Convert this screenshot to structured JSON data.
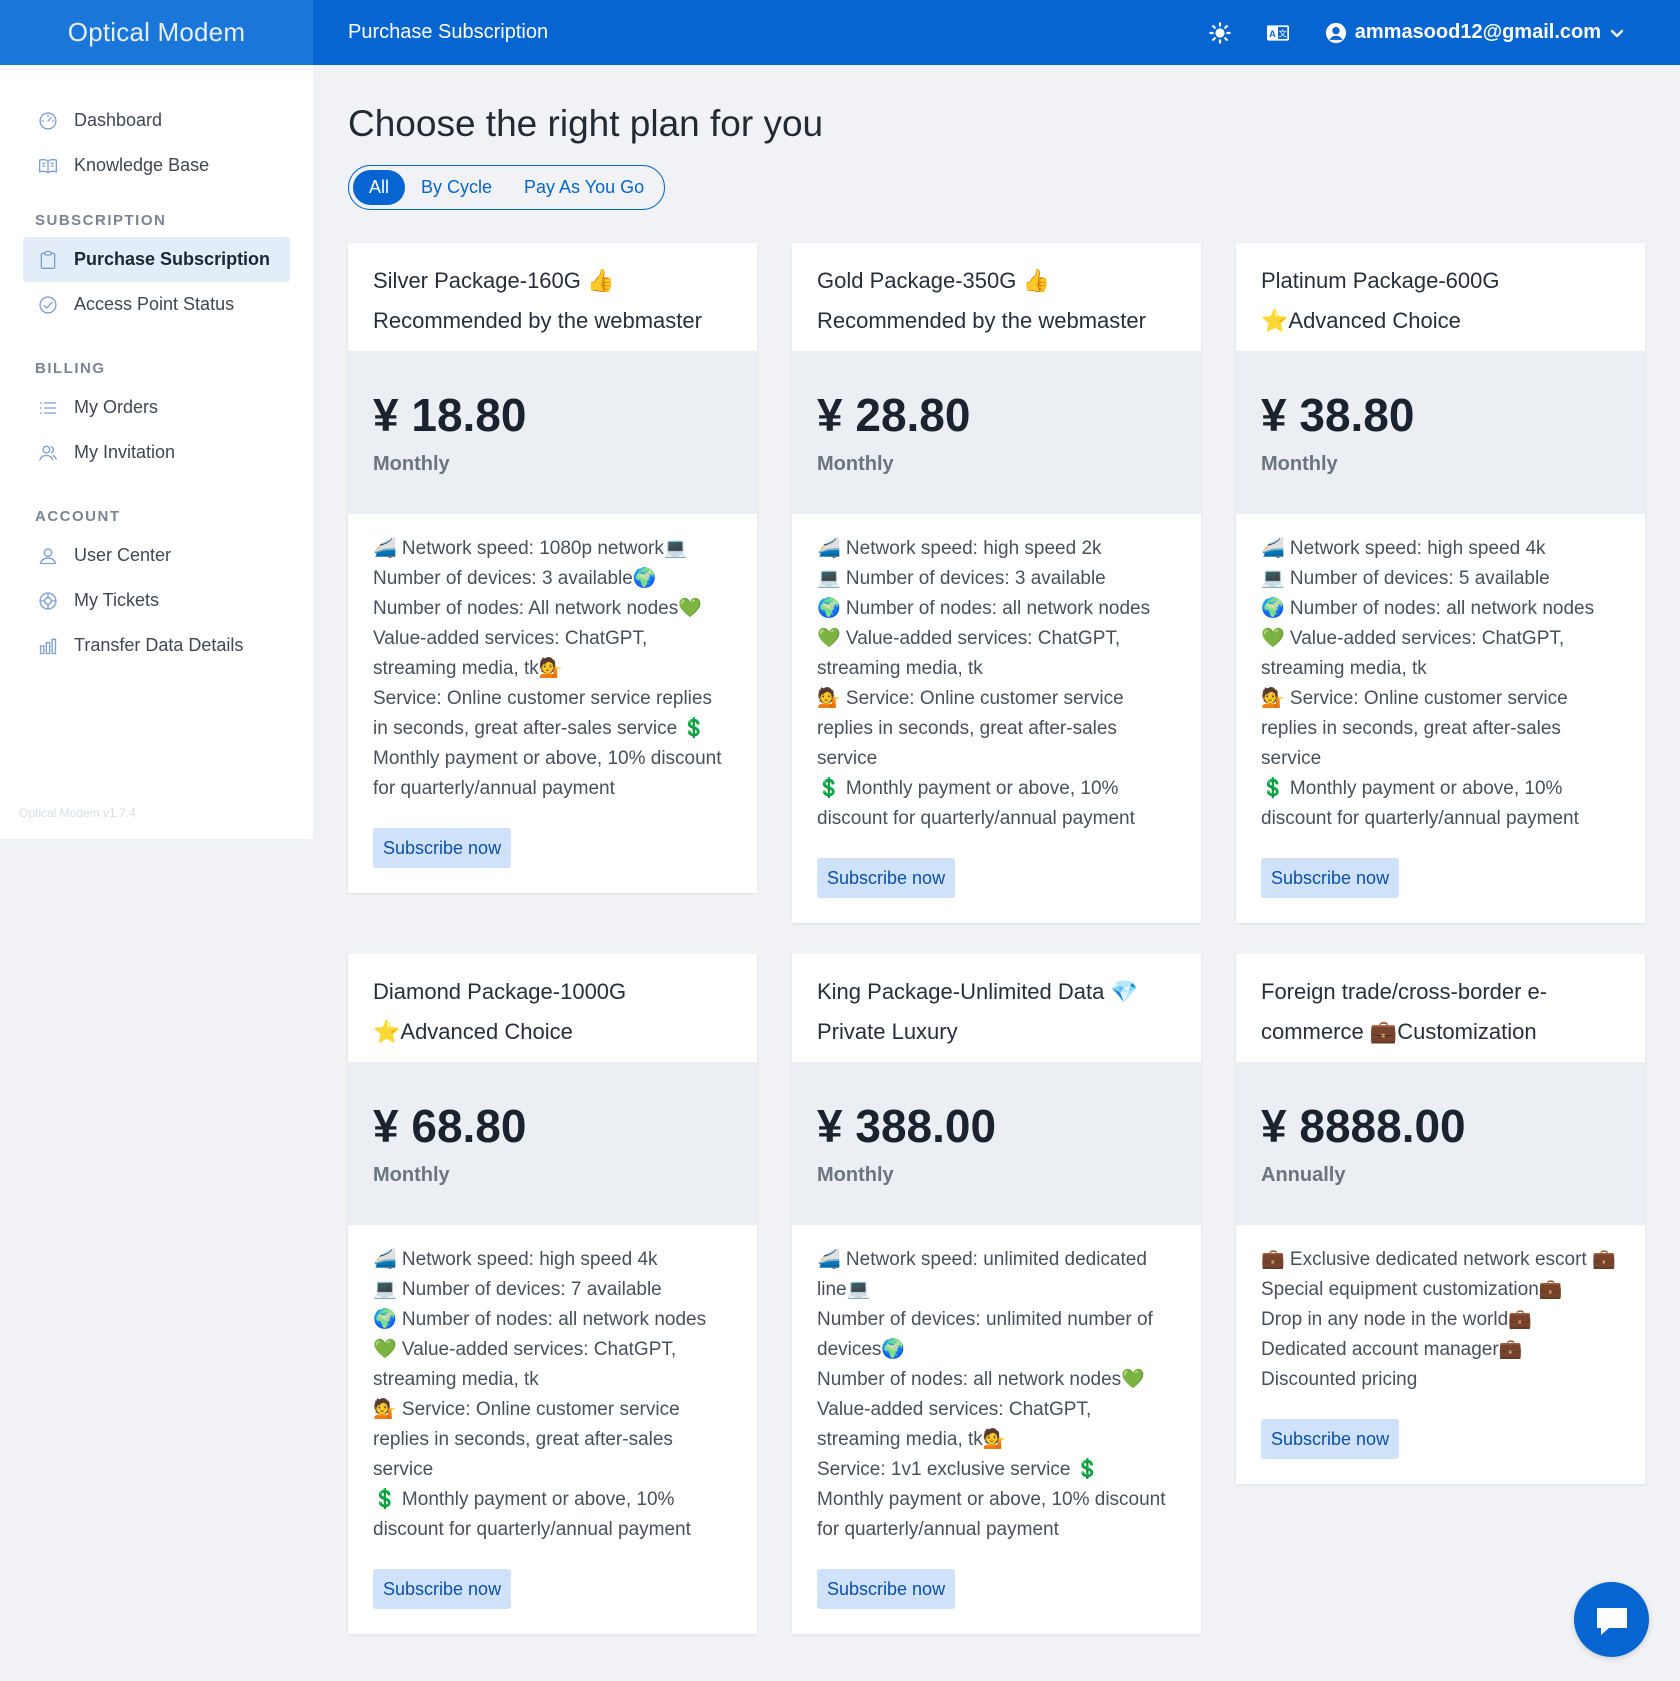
{
  "app": {
    "brand": "Optical Modem",
    "page_title": "Purchase Subscription",
    "user_email": "ammasood12@gmail.com",
    "version": "Optical Modem v1.7.4"
  },
  "sidebar": {
    "items_top": [
      {
        "label": "Dashboard",
        "icon": "dashboard-icon"
      },
      {
        "label": "Knowledge Base",
        "icon": "book-icon"
      }
    ],
    "sections": [
      {
        "title": "SUBSCRIPTION",
        "items": [
          {
            "label": "Purchase Subscription",
            "icon": "clipboard-icon",
            "active": true
          },
          {
            "label": "Access Point Status",
            "icon": "check-circle-icon"
          }
        ]
      },
      {
        "title": "BILLING",
        "items": [
          {
            "label": "My Orders",
            "icon": "list-icon"
          },
          {
            "label": "My Invitation",
            "icon": "users-icon"
          }
        ]
      },
      {
        "title": "ACCOUNT",
        "items": [
          {
            "label": "User Center",
            "icon": "user-icon"
          },
          {
            "label": "My Tickets",
            "icon": "lifebuoy-icon"
          },
          {
            "label": "Transfer Data Details",
            "icon": "bar-chart-icon"
          }
        ]
      }
    ]
  },
  "main": {
    "heading": "Choose the right plan for you",
    "filters": [
      "All",
      "By Cycle",
      "Pay As You Go"
    ],
    "active_filter": "All",
    "subscribe_label": "Subscribe now"
  },
  "plans": [
    {
      "title_line1": "Silver Package-160G 👍",
      "title_line2": "Recommended by the webmaster",
      "price": "¥ 18.80",
      "cycle": "Monthly",
      "features": [
        "🚄 Network speed: 1080p network💻",
        "Number of devices: 3 available🌍",
        "Number of nodes: All network nodes💚",
        "Value-added services: ChatGPT, streaming media, tk💁",
        "Service: Online customer service replies in seconds, great after-sales service 💲",
        "Monthly payment or above, 10% discount for quarterly/annual payment"
      ]
    },
    {
      "title_line1": "Gold Package-350G 👍",
      "title_line2": "Recommended by the webmaster",
      "price": "¥ 28.80",
      "cycle": "Monthly",
      "features": [
        "🚄 Network speed: high speed 2k",
        "💻 Number of devices: 3 available",
        "🌍 Number of nodes: all network nodes",
        "💚 Value-added services: ChatGPT, streaming media, tk",
        "💁 Service: Online customer service replies in seconds, great after-sales service",
        "💲 Monthly payment or above, 10% discount for quarterly/annual payment"
      ]
    },
    {
      "title_line1": "Platinum Package-600G",
      "title_line2": "⭐Advanced Choice",
      "price": "¥ 38.80",
      "cycle": "Monthly",
      "features": [
        "🚄 Network speed: high speed 4k",
        "💻 Number of devices: 5 available",
        "🌍 Number of nodes: all network nodes",
        "💚 Value-added services: ChatGPT, streaming media, tk",
        "💁 Service: Online customer service replies in seconds, great after-sales service",
        "💲 Monthly payment or above, 10% discount for quarterly/annual payment"
      ]
    },
    {
      "title_line1": "Diamond Package-1000G",
      "title_line2": "⭐Advanced Choice",
      "price": "¥ 68.80",
      "cycle": "Monthly",
      "features": [
        "🚄 Network speed: high speed 4k",
        "💻 Number of devices: 7 available",
        "🌍 Number of nodes: all network nodes",
        "💚 Value-added services: ChatGPT, streaming media, tk",
        "💁 Service: Online customer service replies in seconds, great after-sales service",
        "💲 Monthly payment or above, 10% discount for quarterly/annual payment"
      ]
    },
    {
      "title_line1": "King Package-Unlimited Data 💎",
      "title_line2": "Private Luxury",
      "price": "¥ 388.00",
      "cycle": "Monthly",
      "features": [
        "🚄 Network speed: unlimited dedicated line💻",
        "Number of devices: unlimited number of devices🌍",
        "Number of nodes: all network nodes💚",
        "Value-added services: ChatGPT, streaming media, tk💁",
        "Service: 1v1 exclusive service 💲",
        "Monthly payment or above, 10% discount for quarterly/annual payment"
      ]
    },
    {
      "title_line1": "Foreign trade/cross-border e-commerce 💼Customization",
      "title_line2": "",
      "price": "¥ 8888.00",
      "cycle": "Annually",
      "features": [
        "💼 Exclusive dedicated network escort 💼",
        "Special equipment customization💼",
        "Drop in any node in the world💼",
        "Dedicated account manager💼",
        "Discounted pricing"
      ]
    }
  ]
}
